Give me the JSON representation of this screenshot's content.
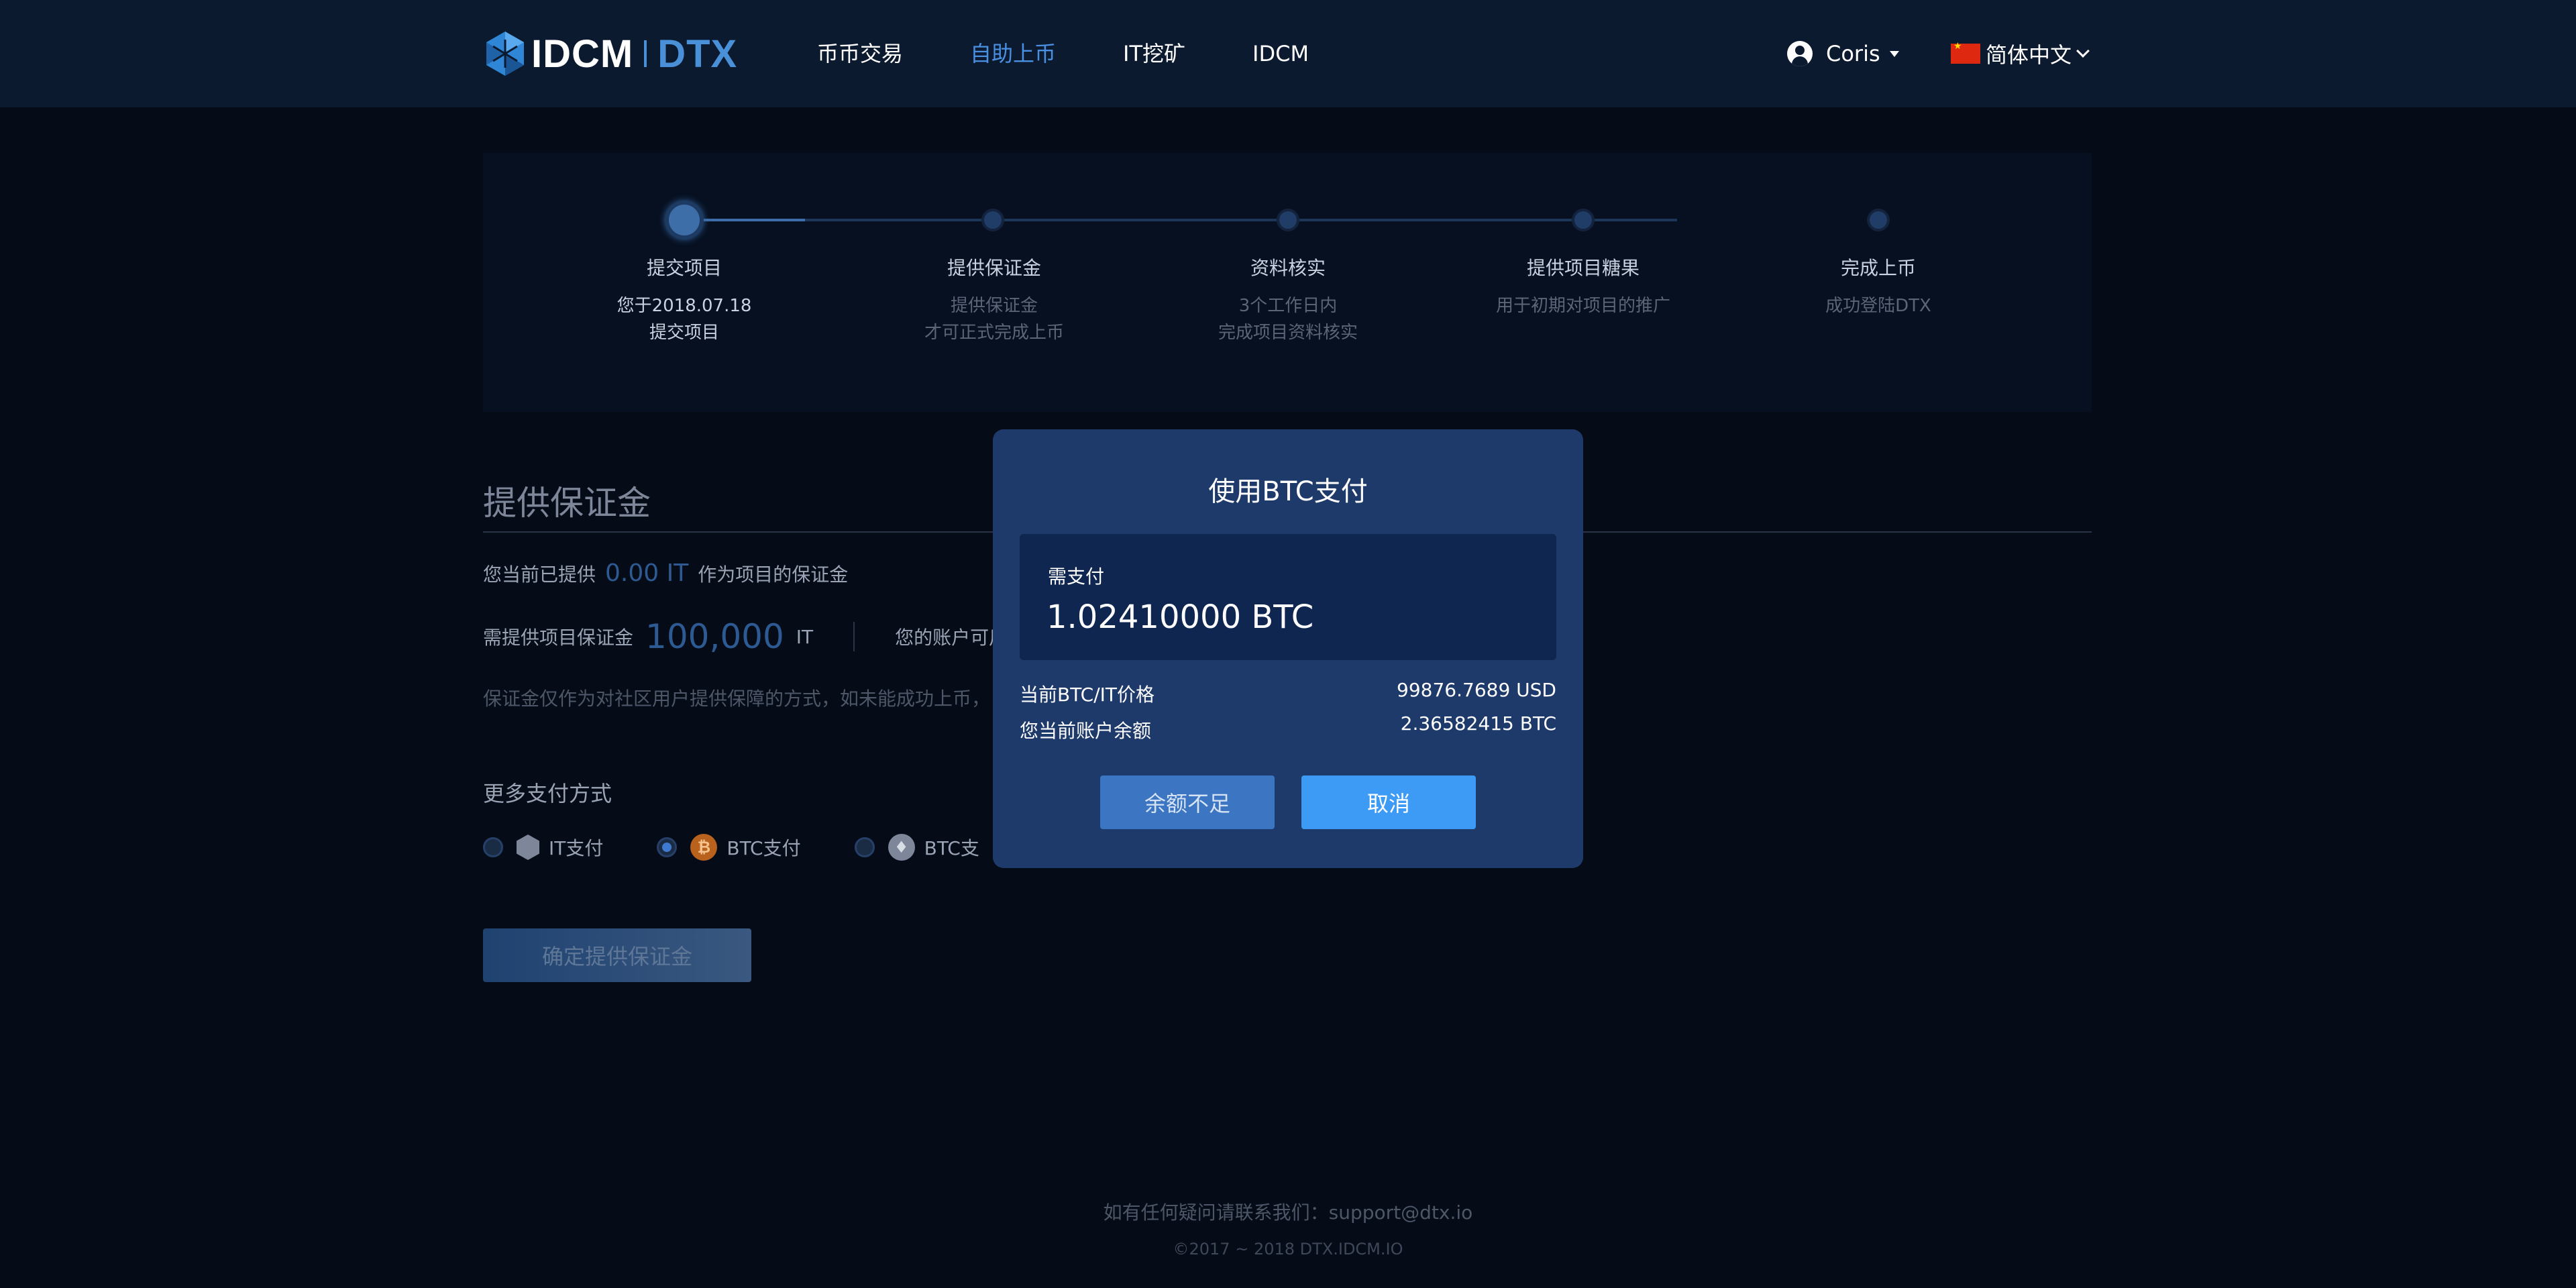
{
  "header": {
    "logo": {
      "brand": "IDCM",
      "product": "DTX"
    },
    "nav": [
      {
        "label": "币币交易",
        "active": false
      },
      {
        "label": "自助上币",
        "active": true
      },
      {
        "label": "IT挖矿",
        "active": false
      },
      {
        "label": "IDCM",
        "active": false
      }
    ],
    "user": {
      "name": "Coris",
      "icon": "user-icon"
    },
    "language": {
      "label": "简体中文",
      "icon": "cn-flag-icon"
    }
  },
  "steps": [
    {
      "title": "提交项目",
      "desc_line1": "您于2018.07.18",
      "desc_line2": "提交项目",
      "state": "active"
    },
    {
      "title": "提供保证金",
      "desc_line1": "提供保证金",
      "desc_line2": "才可正式完成上币",
      "state": "pending"
    },
    {
      "title": "资料核实",
      "desc_line1": "3个工作日内",
      "desc_line2": "完成项目资料核实",
      "state": "pending"
    },
    {
      "title": "提供项目糖果",
      "desc_line1": "用于初期对项目的推广",
      "desc_line2": "",
      "state": "pending"
    },
    {
      "title": "完成上币",
      "desc_line1": "成功登陆DTX",
      "desc_line2": "",
      "state": "pending"
    }
  ],
  "deposit": {
    "title": "提供保证金",
    "provided_prefix": "您当前已提供",
    "provided_value": "0.00 IT",
    "provided_suffix": "作为项目的保证金",
    "required_label": "需提供项目保证金",
    "required_value": "100,000",
    "required_unit": "IT",
    "available_label": "您的账户可用：",
    "note": "保证金仅作为对社区用户提供保障的方式，如未能成功上币，",
    "more_title": "更多支付方式",
    "methods": [
      {
        "label": "IT支付",
        "icon": "it-coin-icon",
        "checked": false
      },
      {
        "label": "BTC支付",
        "icon": "btc-coin-icon",
        "checked": true
      },
      {
        "label": "BTC支",
        "icon": "eth-coin-icon",
        "checked": false
      }
    ],
    "confirm_label": "确定提供保证金"
  },
  "modal": {
    "title": "使用BTC支付",
    "need_pay_label": "需支付",
    "need_pay_value": "1.02410000 BTC",
    "price_label": "当前BTC/IT价格",
    "price_value": "99876.7689 USD",
    "balance_label": "您当前账户余额",
    "balance_value": "2.36582415 BTC",
    "insufficient_label": "余额不足",
    "cancel_label": "取消"
  },
  "footer": {
    "contact": "如有任何疑问请联系我们：support@dtx.io",
    "copyright": "©2017 ~ 2018 DTX.IDCM.IO"
  },
  "colors": {
    "accent": "#4a90e2",
    "modal_bg": "#1e3a6b",
    "cancel_button": "#3d9bf5",
    "page_bg": "#050c18"
  }
}
